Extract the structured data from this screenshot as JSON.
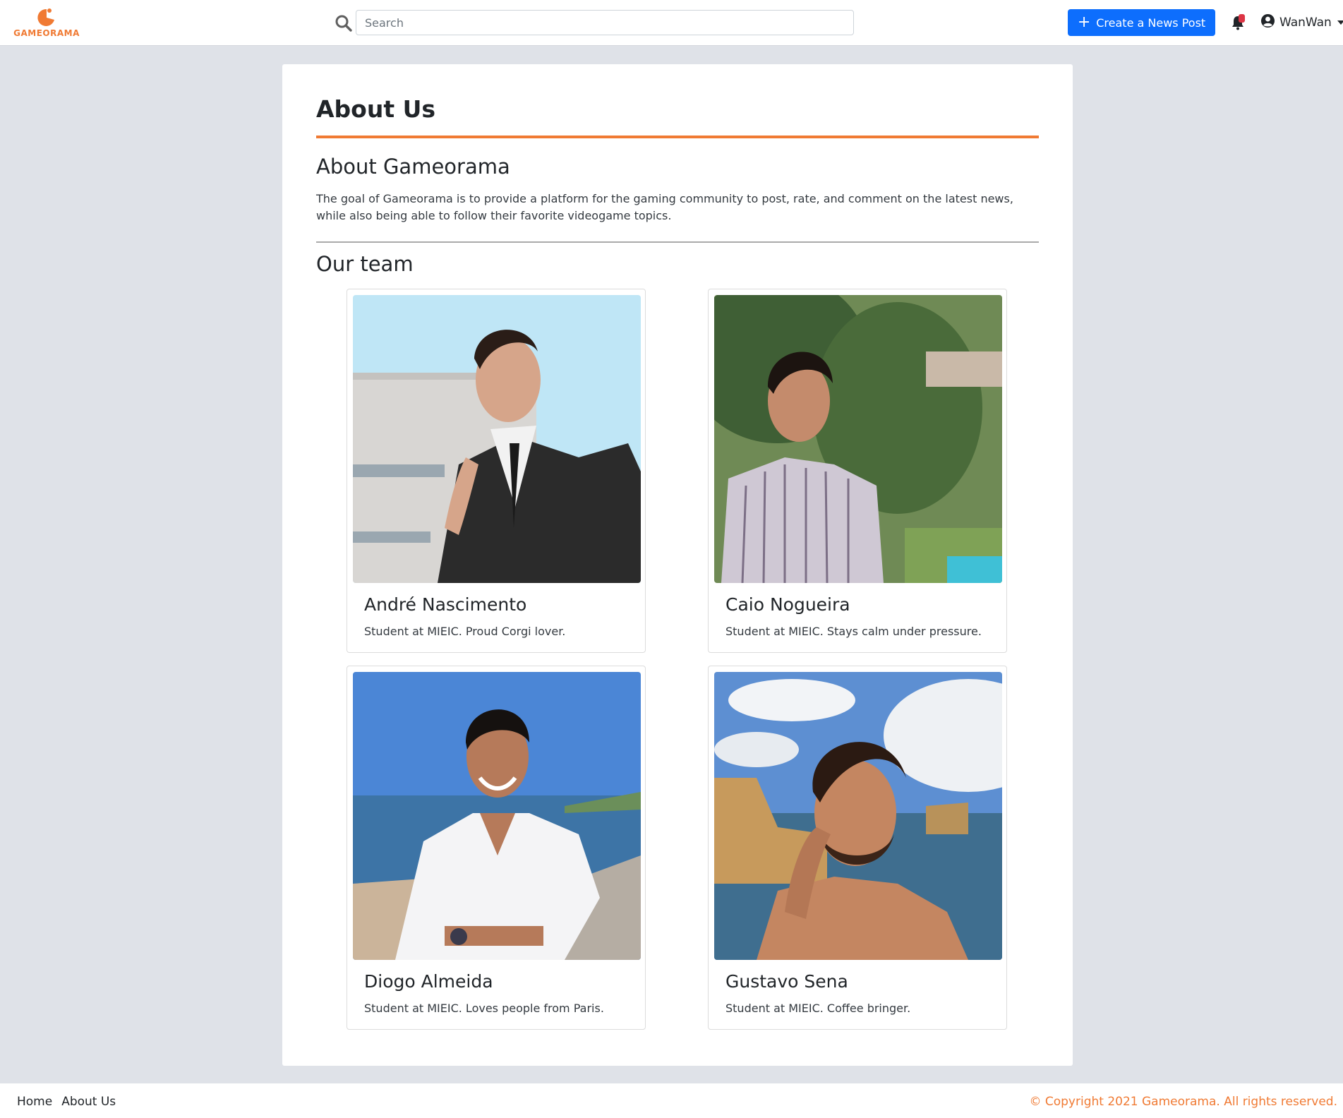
{
  "brand": {
    "name": "GAMEORAMA",
    "accent_color": "#f07a33"
  },
  "header": {
    "search": {
      "placeholder": "Search",
      "value": "",
      "icon": "search-icon"
    },
    "create_button": {
      "label": "Create a News Post",
      "icon": "plus-icon",
      "color": "#0d6efd"
    },
    "notifications": {
      "icon": "bell-icon",
      "badge_color": "#dc3545"
    },
    "user": {
      "name": "WanWan",
      "icon": "user-circle-icon"
    }
  },
  "main": {
    "title": "About Us",
    "about": {
      "heading": "About Gameorama",
      "text": "The goal of Gameorama is to provide a platform for the gaming community to post, rate, and comment on the latest news, while also being able to follow their favorite videogame topics."
    },
    "team": {
      "heading": "Our team",
      "members": [
        {
          "name": "André Nascimento",
          "description": "Student at MIEIC. Proud Corgi lover."
        },
        {
          "name": "Caio Nogueira",
          "description": "Student at MIEIC. Stays calm under pressure."
        },
        {
          "name": "Diogo Almeida",
          "description": "Student at MIEIC. Loves people from Paris."
        },
        {
          "name": "Gustavo Sena",
          "description": "Student at MIEIC. Coffee bringer."
        }
      ]
    }
  },
  "footer": {
    "links": [
      "Home",
      "About Us"
    ],
    "copyright": "© Copyright 2021 Gameorama. All rights reserved."
  }
}
